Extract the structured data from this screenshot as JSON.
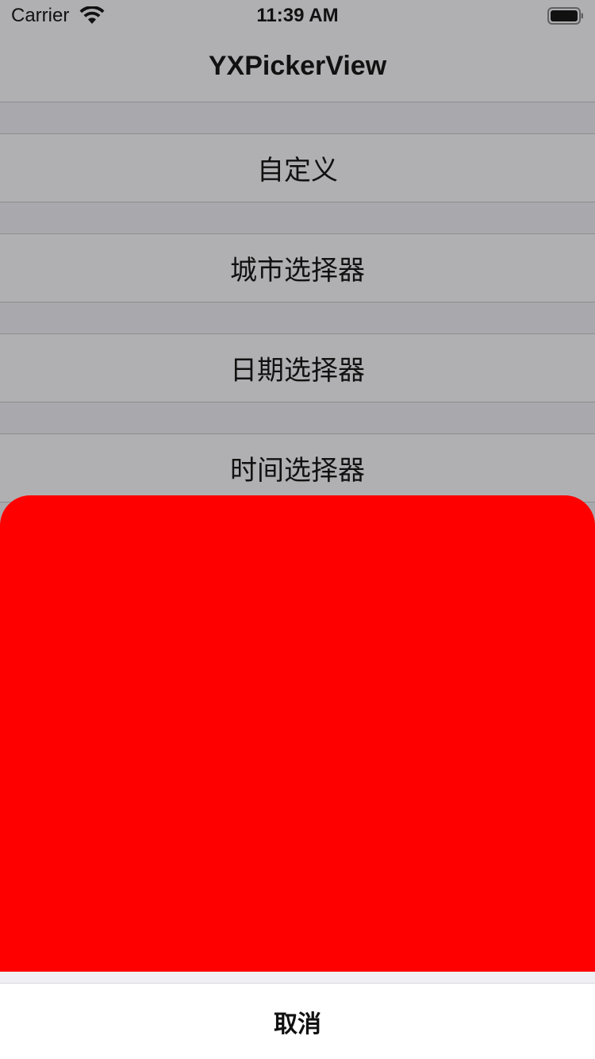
{
  "status_bar": {
    "carrier": "Carrier",
    "time": "11:39 AM",
    "wifi_icon": "wifi-icon",
    "battery_icon": "battery-icon"
  },
  "nav": {
    "title": "YXPickerView"
  },
  "list": {
    "items": [
      {
        "label": "自定义"
      },
      {
        "label": "城市选择器"
      },
      {
        "label": "日期选择器"
      },
      {
        "label": "时间选择器"
      }
    ]
  },
  "sheet": {
    "color": "#ff0000",
    "cancel_label": "取消"
  },
  "colors": {
    "dim_background": "#b0b0b2",
    "separator": "#8d8d90"
  }
}
